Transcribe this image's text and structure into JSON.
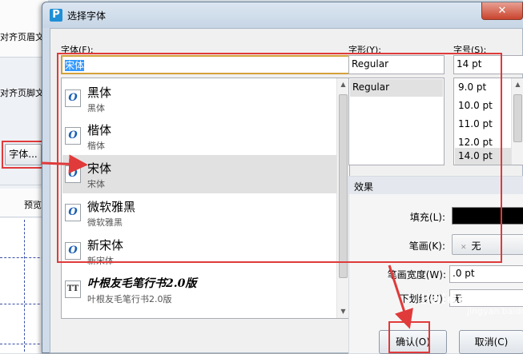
{
  "background": {
    "header_align_text": "对齐页眉文",
    "footer_align_text": "对齐页脚文",
    "font_button_label": "字体...",
    "preview_label": "预览"
  },
  "dialog": {
    "title": "选择字体",
    "app_icon_letter": "P",
    "font_label": "字体(F):",
    "style_label": "字形(Y):",
    "size_label": "字号(S):",
    "font_input_value": "宋体",
    "fonts": [
      {
        "name": "黑体",
        "preview": "黑体"
      },
      {
        "name": "楷体",
        "preview": "楷体"
      },
      {
        "name": "宋体",
        "preview": "宋体"
      },
      {
        "name": "微软雅黑",
        "preview": "微软雅黑"
      },
      {
        "name": "新宋体",
        "preview": "新宋体"
      },
      {
        "name": "叶根友毛笔行书2.0版",
        "preview": "叶根友毛笔行书2.0版"
      }
    ],
    "selected_font": "宋体",
    "style_input_value": "Regular",
    "styles": [
      "Regular"
    ],
    "size_input_value": "14 pt",
    "sizes": [
      "9.0 pt",
      "10.0 pt",
      "11.0 pt",
      "12.0 pt",
      "14.0 pt"
    ],
    "selected_size": "14.0 pt",
    "effects": {
      "header": "效果",
      "fill_label": "填充(L):",
      "fill_color": "#000000",
      "stroke_label": "笔画(K):",
      "stroke_value": "无",
      "stroke_width_label": "笔画宽度(W):",
      "stroke_width_value": ".0 pt",
      "underline_label": "下划线(U):",
      "underline_value": "无"
    },
    "ok_label": "确认(O)",
    "cancel_label": "取消(C)"
  },
  "watermark": {
    "brand": "Baidu 经验",
    "sub": "jingyan.baidu.com"
  },
  "colors": {
    "annotation_red": "#e03a3a",
    "selection_blue": "#3399ff"
  }
}
